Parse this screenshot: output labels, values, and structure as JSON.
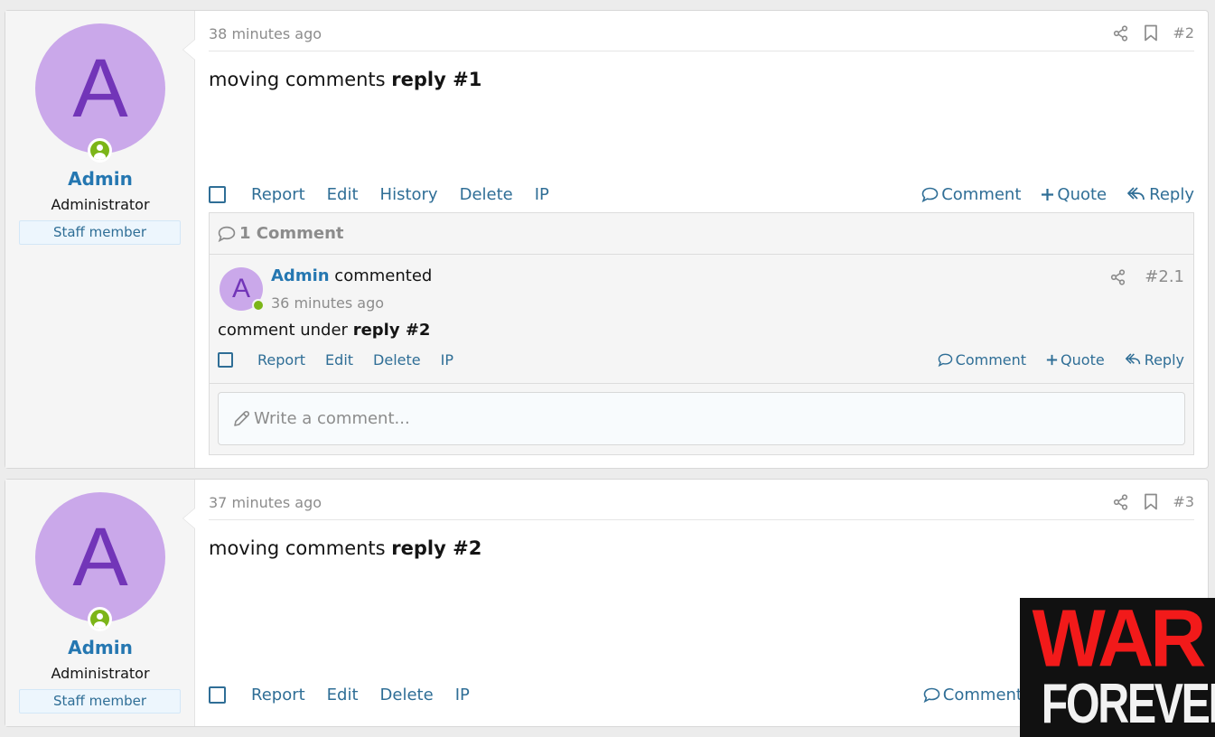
{
  "posts": [
    {
      "user": {
        "avatar_letter": "A",
        "name": "Admin",
        "title": "Administrator",
        "badge": "Staff member"
      },
      "timestamp": "38 minutes ago",
      "post_number": "#2",
      "body_plain": "moving comments ",
      "body_bold": "reply #1",
      "actions_left": [
        "Report",
        "Edit",
        "History",
        "Delete",
        "IP"
      ],
      "actions_right": [
        "Comment",
        "Quote",
        "Reply"
      ],
      "comments": {
        "header": "1 Comment",
        "items": [
          {
            "avatar_letter": "A",
            "author": "Admin",
            "verb": "commented",
            "timestamp": "36 minutes ago",
            "number": "#2.1",
            "body_plain": "comment under ",
            "body_bold": "reply #2",
            "actions_left": [
              "Report",
              "Edit",
              "Delete",
              "IP"
            ],
            "actions_right": [
              "Comment",
              "Quote",
              "Reply"
            ]
          }
        ],
        "write_placeholder": "Write a comment..."
      }
    },
    {
      "user": {
        "avatar_letter": "A",
        "name": "Admin",
        "title": "Administrator",
        "badge": "Staff member"
      },
      "timestamp": "37 minutes ago",
      "post_number": "#3",
      "body_plain": "moving comments ",
      "body_bold": "reply #2",
      "actions_left": [
        "Report",
        "Edit",
        "Delete",
        "IP"
      ],
      "actions_right": [
        "Comment"
      ]
    }
  ],
  "overlay_logo": {
    "line1": "WAR",
    "line2": "FOREVER"
  },
  "colors": {
    "link": "#2f6e96",
    "username": "#2577b1",
    "avatar_bg": "#caa8ea",
    "avatar_letter": "#7235b8",
    "online": "#7cb518",
    "muted": "#8c8c8c"
  }
}
